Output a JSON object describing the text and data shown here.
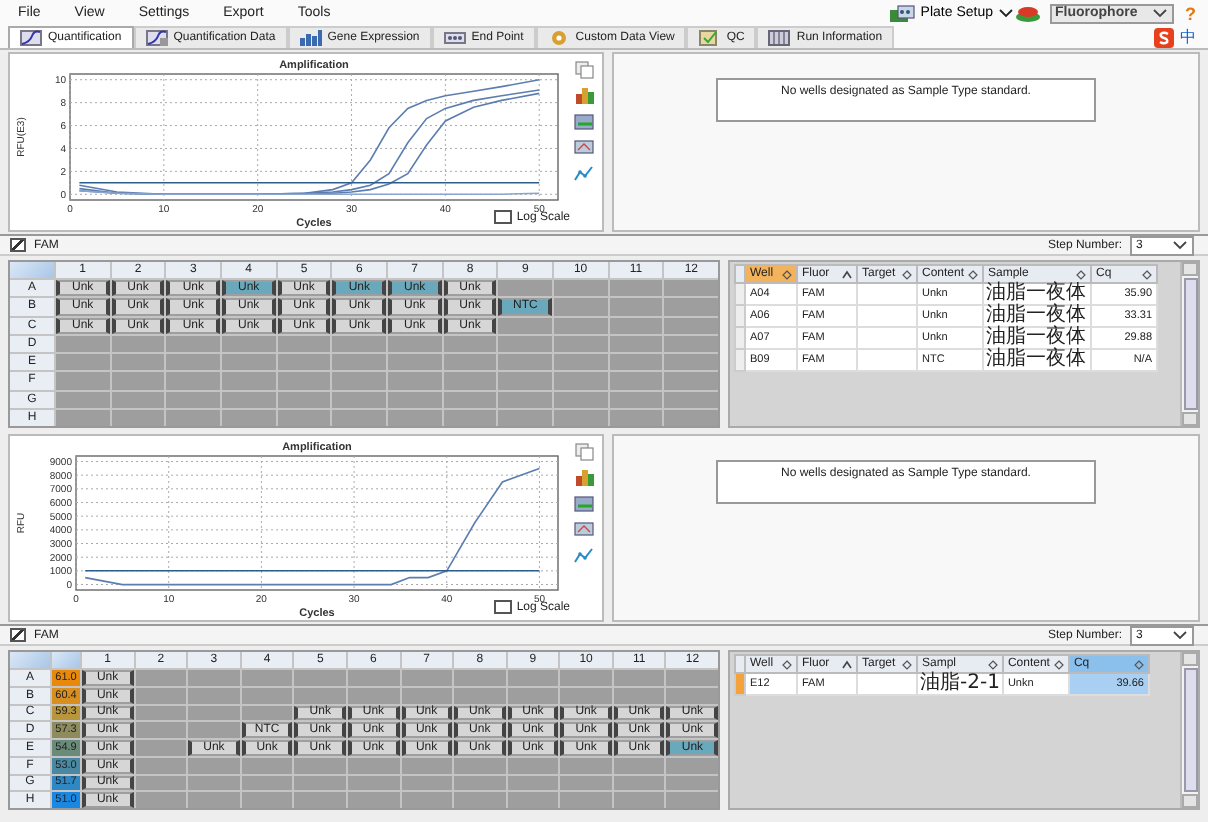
{
  "menu": [
    "File",
    "View",
    "Settings",
    "Export",
    "Tools"
  ],
  "toolbar": {
    "plate_setup": "Plate Setup",
    "fluorophore": "Fluorophore",
    "help": "?"
  },
  "tabs": [
    {
      "label": "Quantification",
      "selected": true
    },
    {
      "label": "Quantification Data",
      "selected": false
    },
    {
      "label": "Gene Expression",
      "selected": false
    },
    {
      "label": "End Point",
      "selected": false
    },
    {
      "label": "Custom Data View",
      "selected": false
    },
    {
      "label": "QC",
      "selected": false
    },
    {
      "label": "Run Information",
      "selected": false
    }
  ],
  "ime": "中",
  "sections": [
    {
      "chart": {
        "chart_data": {
          "type": "line",
          "title": "Amplification",
          "xlabel": "Cycles",
          "ylabel": "RFU(E3)",
          "x": [
            1,
            5,
            10,
            15,
            20,
            25,
            28,
            30,
            32,
            34,
            36,
            38,
            40,
            43,
            46,
            50
          ],
          "xlim": [
            0,
            52
          ],
          "ylim": [
            -0.5,
            10.5
          ],
          "xticks": [
            0,
            10,
            20,
            30,
            40,
            50
          ],
          "yticks": [
            0,
            2,
            4,
            6,
            8,
            10
          ],
          "grid": true,
          "series": [
            {
              "color": "#5b7db0",
              "values": [
                0.5,
                0.1,
                0,
                0,
                0,
                0.1,
                0.4,
                1.0,
                3.0,
                5.8,
                7.5,
                8.2,
                8.6,
                9.0,
                9.4,
                10.0
              ]
            },
            {
              "color": "#5b7db0",
              "values": [
                0.3,
                0.1,
                0,
                0,
                0,
                0.1,
                0.2,
                0.4,
                0.8,
                1.8,
                4.5,
                6.6,
                7.5,
                8.2,
                8.6,
                9.1
              ]
            },
            {
              "color": "#5b7db0",
              "values": [
                0.8,
                0.2,
                0,
                0,
                0,
                0,
                0.1,
                0.2,
                0.4,
                0.9,
                1.8,
                4.3,
                6.4,
                7.6,
                8.2,
                8.8
              ]
            },
            {
              "color": "#8aa6cc",
              "values": [
                0.3,
                0.1,
                0,
                0,
                0,
                0,
                0,
                0,
                0,
                0,
                0,
                0,
                0,
                0,
                0,
                0.1
              ]
            },
            {
              "color": "#2c5c8c",
              "values": [
                1,
                1,
                1,
                1,
                1,
                1,
                1,
                1,
                1,
                1,
                1,
                1,
                1,
                1,
                1,
                1
              ]
            }
          ]
        },
        "log_scale": {
          "label": "Log Scale",
          "checked": false
        }
      },
      "standard_message": "No wells designated as Sample Type standard.",
      "channel": {
        "label": "FAM",
        "checked": true
      },
      "step_number": {
        "label": "Step Number:",
        "value": "3"
      },
      "plate": {
        "columns": [
          "1",
          "2",
          "3",
          "4",
          "5",
          "6",
          "7",
          "8",
          "9",
          "10",
          "11",
          "12"
        ],
        "rows": [
          {
            "label": "A",
            "cells": [
              {
                "kind": "sample",
                "text": "Unk",
                "selected": false
              },
              {
                "kind": "sample",
                "text": "Unk",
                "selected": false
              },
              {
                "kind": "sample",
                "text": "Unk",
                "selected": false
              },
              {
                "kind": "sample",
                "text": "Unk",
                "selected": true
              },
              {
                "kind": "sample",
                "text": "Unk",
                "selected": false
              },
              {
                "kind": "sample",
                "text": "Unk",
                "selected": true
              },
              {
                "kind": "sample",
                "text": "Unk",
                "selected": true
              },
              {
                "kind": "sample",
                "text": "Unk",
                "selected": false
              },
              {
                "kind": "empty"
              },
              {
                "kind": "empty"
              },
              {
                "kind": "empty"
              },
              {
                "kind": "empty"
              }
            ]
          },
          {
            "label": "B",
            "cells": [
              {
                "kind": "sample",
                "text": "Unk",
                "selected": false
              },
              {
                "kind": "sample",
                "text": "Unk",
                "selected": false
              },
              {
                "kind": "sample",
                "text": "Unk",
                "selected": false
              },
              {
                "kind": "sample",
                "text": "Unk",
                "selected": false
              },
              {
                "kind": "sample",
                "text": "Unk",
                "selected": false
              },
              {
                "kind": "sample",
                "text": "Unk",
                "selected": false
              },
              {
                "kind": "sample",
                "text": "Unk",
                "selected": false
              },
              {
                "kind": "sample",
                "text": "Unk",
                "selected": false
              },
              {
                "kind": "sample",
                "text": "NTC",
                "selected": true
              },
              {
                "kind": "empty"
              },
              {
                "kind": "empty"
              },
              {
                "kind": "empty"
              }
            ]
          },
          {
            "label": "C",
            "cells": [
              {
                "kind": "sample",
                "text": "Unk",
                "selected": false
              },
              {
                "kind": "sample",
                "text": "Unk",
                "selected": false
              },
              {
                "kind": "sample",
                "text": "Unk",
                "selected": false
              },
              {
                "kind": "sample",
                "text": "Unk",
                "selected": false
              },
              {
                "kind": "sample",
                "text": "Unk",
                "selected": false
              },
              {
                "kind": "sample",
                "text": "Unk",
                "selected": false
              },
              {
                "kind": "sample",
                "text": "Unk",
                "selected": false
              },
              {
                "kind": "sample",
                "text": "Unk",
                "selected": false
              },
              {
                "kind": "empty"
              },
              {
                "kind": "empty"
              },
              {
                "kind": "empty"
              },
              {
                "kind": "empty"
              }
            ]
          },
          {
            "label": "D",
            "cells": [
              {
                "kind": "empty"
              },
              {
                "kind": "empty"
              },
              {
                "kind": "empty"
              },
              {
                "kind": "empty"
              },
              {
                "kind": "empty"
              },
              {
                "kind": "empty"
              },
              {
                "kind": "empty"
              },
              {
                "kind": "empty"
              },
              {
                "kind": "empty"
              },
              {
                "kind": "empty"
              },
              {
                "kind": "empty"
              },
              {
                "kind": "empty"
              }
            ]
          },
          {
            "label": "E",
            "cells": [
              {
                "kind": "empty"
              },
              {
                "kind": "empty"
              },
              {
                "kind": "empty"
              },
              {
                "kind": "empty"
              },
              {
                "kind": "empty"
              },
              {
                "kind": "empty"
              },
              {
                "kind": "empty"
              },
              {
                "kind": "empty"
              },
              {
                "kind": "empty"
              },
              {
                "kind": "empty"
              },
              {
                "kind": "empty"
              },
              {
                "kind": "empty"
              }
            ]
          },
          {
            "label": "F",
            "cells": [
              {
                "kind": "empty"
              },
              {
                "kind": "empty"
              },
              {
                "kind": "empty"
              },
              {
                "kind": "empty"
              },
              {
                "kind": "empty"
              },
              {
                "kind": "empty"
              },
              {
                "kind": "empty"
              },
              {
                "kind": "empty"
              },
              {
                "kind": "empty"
              },
              {
                "kind": "empty"
              },
              {
                "kind": "empty"
              },
              {
                "kind": "empty"
              }
            ]
          },
          {
            "label": "G",
            "cells": [
              {
                "kind": "empty"
              },
              {
                "kind": "empty"
              },
              {
                "kind": "empty"
              },
              {
                "kind": "empty"
              },
              {
                "kind": "empty"
              },
              {
                "kind": "empty"
              },
              {
                "kind": "empty"
              },
              {
                "kind": "empty"
              },
              {
                "kind": "empty"
              },
              {
                "kind": "empty"
              },
              {
                "kind": "empty"
              },
              {
                "kind": "empty"
              }
            ]
          },
          {
            "label": "H",
            "cells": [
              {
                "kind": "empty"
              },
              {
                "kind": "empty"
              },
              {
                "kind": "empty"
              },
              {
                "kind": "empty"
              },
              {
                "kind": "empty"
              },
              {
                "kind": "empty"
              },
              {
                "kind": "empty"
              },
              {
                "kind": "empty"
              },
              {
                "kind": "empty"
              },
              {
                "kind": "empty"
              },
              {
                "kind": "empty"
              },
              {
                "kind": "empty"
              }
            ]
          }
        ]
      },
      "table": {
        "columns": [
          {
            "kind": "well",
            "label": "Well",
            "sorted": false,
            "selected": true
          },
          {
            "kind": "fluor",
            "label": "Fluor",
            "sorted": true,
            "selected": false
          },
          {
            "kind": "target",
            "label": "Target",
            "sorted": false,
            "selected": false
          },
          {
            "kind": "content",
            "label": "Content",
            "sorted": false,
            "selected": false
          },
          {
            "kind": "sample",
            "label": "Sample",
            "sorted": false,
            "selected": false
          },
          {
            "kind": "cq",
            "label": "Cq",
            "sorted": false,
            "selected": false
          }
        ],
        "rows": [
          {
            "well": "A04",
            "fluor": "FAM",
            "content": "Unkn",
            "sample": "油脂一夜体",
            "cq": "35.90",
            "selected": false
          },
          {
            "well": "A06",
            "fluor": "FAM",
            "content": "Unkn",
            "sample": "油脂一夜体",
            "cq": "33.31",
            "selected": false
          },
          {
            "well": "A07",
            "fluor": "FAM",
            "content": "Unkn",
            "sample": "油脂一夜体",
            "cq": "29.88",
            "selected": false
          },
          {
            "well": "B09",
            "fluor": "FAM",
            "content": "NTC",
            "sample": "油脂一夜体",
            "cq": "N/A",
            "selected": false
          }
        ]
      }
    },
    {
      "chart": {
        "chart_data": {
          "type": "line",
          "title": "Amplification",
          "xlabel": "Cycles",
          "ylabel": "RFU",
          "x": [
            1,
            5,
            10,
            15,
            20,
            25,
            28,
            30,
            32,
            34,
            36,
            38,
            40,
            43,
            46,
            50
          ],
          "xlim": [
            0,
            52
          ],
          "ylim": [
            -400,
            9400
          ],
          "xticks": [
            0,
            10,
            20,
            30,
            40,
            50
          ],
          "yticks": [
            0,
            1000,
            2000,
            3000,
            4000,
            5000,
            6000,
            7000,
            8000,
            9000
          ],
          "grid": true,
          "series": [
            {
              "color": "#5b7db0",
              "values": [
                500,
                0,
                0,
                0,
                0,
                0,
                0,
                0,
                0,
                0,
                500,
                500,
                1000,
                4500,
                7500,
                8500
              ]
            },
            {
              "color": "#2c5c8c",
              "values": [
                1000,
                1000,
                1000,
                1000,
                1000,
                1000,
                1000,
                1000,
                1000,
                1000,
                1000,
                1000,
                1000,
                1000,
                1000,
                1000
              ]
            }
          ]
        },
        "log_scale": {
          "label": "Log Scale",
          "checked": false
        }
      },
      "standard_message": "No wells designated as Sample Type standard.",
      "channel": {
        "label": "FAM",
        "checked": true
      },
      "step_number": {
        "label": "Step Number:",
        "value": "3"
      },
      "plate": {
        "columns": [
          "1",
          "2",
          "3",
          "4",
          "5",
          "6",
          "7",
          "8",
          "9",
          "10",
          "11",
          "12"
        ],
        "rows": [
          {
            "label": "A",
            "temperature": "61.0",
            "color": "#e8890c",
            "cells": [
              {
                "kind": "sample",
                "text": "Unk",
                "selected": false
              },
              {
                "kind": "empty"
              },
              {
                "kind": "empty"
              },
              {
                "kind": "empty"
              },
              {
                "kind": "empty"
              },
              {
                "kind": "empty"
              },
              {
                "kind": "empty"
              },
              {
                "kind": "empty"
              },
              {
                "kind": "empty"
              },
              {
                "kind": "empty"
              },
              {
                "kind": "empty"
              },
              {
                "kind": "empty"
              }
            ]
          },
          {
            "label": "B",
            "temperature": "60.4",
            "color": "#d88f20",
            "cells": [
              {
                "kind": "sample",
                "text": "Unk",
                "selected": false
              },
              {
                "kind": "empty"
              },
              {
                "kind": "empty"
              },
              {
                "kind": "empty"
              },
              {
                "kind": "empty"
              },
              {
                "kind": "empty"
              },
              {
                "kind": "empty"
              },
              {
                "kind": "empty"
              },
              {
                "kind": "empty"
              },
              {
                "kind": "empty"
              },
              {
                "kind": "empty"
              },
              {
                "kind": "empty"
              }
            ]
          },
          {
            "label": "C",
            "temperature": "59.3",
            "color": "#b8963e",
            "cells": [
              {
                "kind": "sample",
                "text": "Unk",
                "selected": false
              },
              {
                "kind": "empty"
              },
              {
                "kind": "empty"
              },
              {
                "kind": "empty"
              },
              {
                "kind": "sample",
                "text": "Unk",
                "selected": false
              },
              {
                "kind": "sample",
                "text": "Unk",
                "selected": false
              },
              {
                "kind": "sample",
                "text": "Unk",
                "selected": false
              },
              {
                "kind": "sample",
                "text": "Unk",
                "selected": false
              },
              {
                "kind": "sample",
                "text": "Unk",
                "selected": false
              },
              {
                "kind": "sample",
                "text": "Unk",
                "selected": false
              },
              {
                "kind": "sample",
                "text": "Unk",
                "selected": false
              },
              {
                "kind": "sample",
                "text": "Unk",
                "selected": false
              }
            ]
          },
          {
            "label": "D",
            "temperature": "57.3",
            "color": "#8e8c5e",
            "cells": [
              {
                "kind": "sample",
                "text": "Unk",
                "selected": false
              },
              {
                "kind": "empty"
              },
              {
                "kind": "empty"
              },
              {
                "kind": "sample",
                "text": "NTC",
                "selected": false
              },
              {
                "kind": "sample",
                "text": "Unk",
                "selected": false
              },
              {
                "kind": "sample",
                "text": "Unk",
                "selected": false
              },
              {
                "kind": "sample",
                "text": "Unk",
                "selected": false
              },
              {
                "kind": "sample",
                "text": "Unk",
                "selected": false
              },
              {
                "kind": "sample",
                "text": "Unk",
                "selected": false
              },
              {
                "kind": "sample",
                "text": "Unk",
                "selected": false
              },
              {
                "kind": "sample",
                "text": "Unk",
                "selected": false
              },
              {
                "kind": "sample",
                "text": "Unk",
                "selected": false
              }
            ]
          },
          {
            "label": "E",
            "temperature": "54.9",
            "color": "#6a8a7a",
            "cells": [
              {
                "kind": "sample",
                "text": "Unk",
                "selected": false
              },
              {
                "kind": "empty"
              },
              {
                "kind": "sample",
                "text": "Unk",
                "selected": false
              },
              {
                "kind": "sample",
                "text": "Unk",
                "selected": false
              },
              {
                "kind": "sample",
                "text": "Unk",
                "selected": false
              },
              {
                "kind": "sample",
                "text": "Unk",
                "selected": false
              },
              {
                "kind": "sample",
                "text": "Unk",
                "selected": false
              },
              {
                "kind": "sample",
                "text": "Unk",
                "selected": false
              },
              {
                "kind": "sample",
                "text": "Unk",
                "selected": false
              },
              {
                "kind": "sample",
                "text": "Unk",
                "selected": false
              },
              {
                "kind": "sample",
                "text": "Unk",
                "selected": false
              },
              {
                "kind": "sample",
                "text": "Unk",
                "selected": true
              }
            ]
          },
          {
            "label": "F",
            "temperature": "53.0",
            "color": "#4a88a2",
            "cells": [
              {
                "kind": "sample",
                "text": "Unk",
                "selected": false
              },
              {
                "kind": "empty"
              },
              {
                "kind": "empty"
              },
              {
                "kind": "empty"
              },
              {
                "kind": "empty"
              },
              {
                "kind": "empty"
              },
              {
                "kind": "empty"
              },
              {
                "kind": "empty"
              },
              {
                "kind": "empty"
              },
              {
                "kind": "empty"
              },
              {
                "kind": "empty"
              },
              {
                "kind": "empty"
              }
            ]
          },
          {
            "label": "G",
            "temperature": "51.7",
            "color": "#2e88c4",
            "cells": [
              {
                "kind": "sample",
                "text": "Unk",
                "selected": false
              },
              {
                "kind": "empty"
              },
              {
                "kind": "empty"
              },
              {
                "kind": "empty"
              },
              {
                "kind": "empty"
              },
              {
                "kind": "empty"
              },
              {
                "kind": "empty"
              },
              {
                "kind": "empty"
              },
              {
                "kind": "empty"
              },
              {
                "kind": "empty"
              },
              {
                "kind": "empty"
              },
              {
                "kind": "empty"
              }
            ]
          },
          {
            "label": "H",
            "temperature": "51.0",
            "color": "#1888e2",
            "cells": [
              {
                "kind": "sample",
                "text": "Unk",
                "selected": false
              },
              {
                "kind": "empty"
              },
              {
                "kind": "empty"
              },
              {
                "kind": "empty"
              },
              {
                "kind": "empty"
              },
              {
                "kind": "empty"
              },
              {
                "kind": "empty"
              },
              {
                "kind": "empty"
              },
              {
                "kind": "empty"
              },
              {
                "kind": "empty"
              },
              {
                "kind": "empty"
              },
              {
                "kind": "empty"
              }
            ]
          }
        ]
      },
      "table": {
        "columns": [
          {
            "kind": "well",
            "label": "Well",
            "sorted": false,
            "selected": false
          },
          {
            "kind": "fluor",
            "label": "Fluor",
            "sorted": true,
            "selected": false
          },
          {
            "kind": "target",
            "label": "Target",
            "sorted": false,
            "selected": false
          },
          {
            "kind": "sample",
            "label": "Sampl",
            "sorted": false,
            "selected": false
          },
          {
            "kind": "content",
            "label": "Content",
            "sorted": false,
            "selected": false
          },
          {
            "kind": "cq",
            "label": "Cq",
            "sorted": false,
            "selected": true
          }
        ],
        "rows": [
          {
            "well": "E12",
            "fluor": "FAM",
            "content": "Unkn",
            "sample": "油脂-2-1",
            "cq": "39.66",
            "selected": true
          }
        ]
      }
    }
  ]
}
